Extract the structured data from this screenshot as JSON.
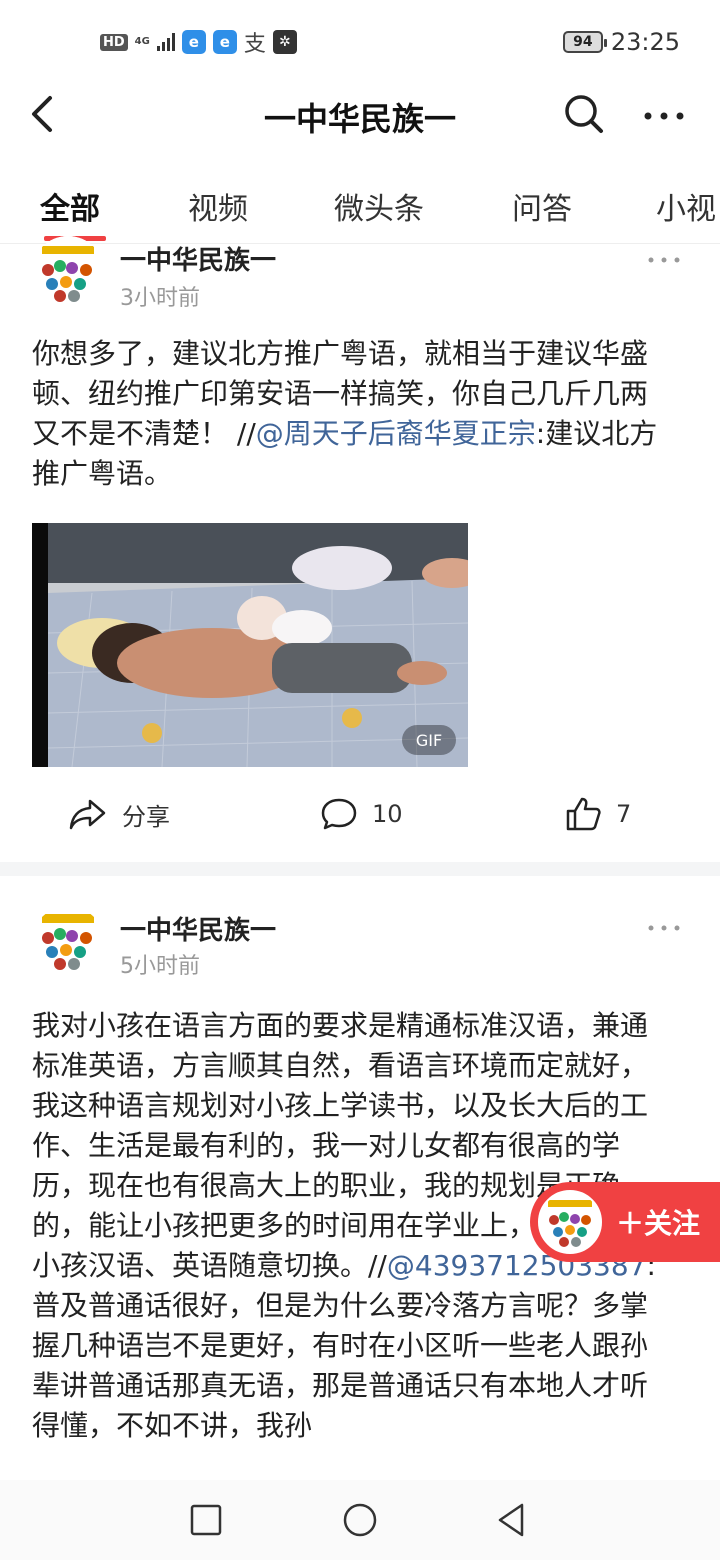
{
  "status_bar": {
    "hd": "HD",
    "network": "4G",
    "app_icon_1": "e",
    "app_icon_2": "e",
    "alipay": "支",
    "battery": "94",
    "time": "23:25"
  },
  "header": {
    "title": "一中华民族一"
  },
  "tabs": [
    {
      "label": "全部",
      "active": true
    },
    {
      "label": "视频"
    },
    {
      "label": "微头条"
    },
    {
      "label": "问答"
    },
    {
      "label": "小视"
    }
  ],
  "posts": [
    {
      "author": "一中华民族一",
      "time": "3小时前",
      "text_before_mention": "你想多了，建议北方推广粤语，就相当于建议华盛顿、纽约推广印第安语一样搞笑，你自己几斤几两又不是不清楚！ //",
      "mention": "@周天子后裔华夏正宗",
      "text_after_mention": ":建议北方推广粤语。",
      "media_badge": "GIF",
      "share_label": "分享",
      "comments": "10",
      "likes": "7"
    },
    {
      "author": "一中华民族一",
      "time": "5小时前",
      "text_before_mention": "我对小孩在语言方面的要求是精通标准汉语，兼通标准英语，方言顺其自然，看语言环境而定就好，我这种语言规划对小孩上学读书，以及长大后的工作、生活是最有利的，我一对儿女都有很高的学历，现在也有很高大上的职业，我的规划是正确的，能让小孩把更多的时间用在学业上，现在我的小孩汉语、英语随意切换。//",
      "mention": "@4393712503387",
      "text_after_mention": ":普及普通话很好，但是为什么要冷落方言呢？多掌握几种语岂不是更好，有时在小区听一些老人跟孙辈讲普通话那真无语，那是普通话只有本地人才听得懂，不如不讲，我孙"
    }
  ],
  "follow_button": {
    "label": "＋关注"
  },
  "colors": {
    "accent": "#f04142",
    "mention": "#406599"
  }
}
